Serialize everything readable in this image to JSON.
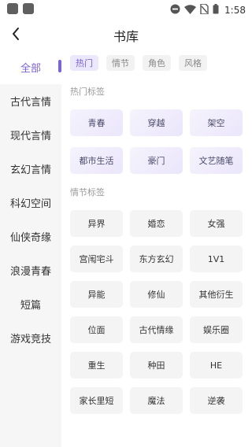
{
  "status_bar": {
    "time": "1:58"
  },
  "header": {
    "title": "书库"
  },
  "sidebar": {
    "items": [
      {
        "label": "全部",
        "active": true
      },
      {
        "label": "古代言情"
      },
      {
        "label": "现代言情"
      },
      {
        "label": "玄幻言情"
      },
      {
        "label": "科幻空间"
      },
      {
        "label": "仙侠奇缘"
      },
      {
        "label": "浪漫青春"
      },
      {
        "label": "短篇"
      },
      {
        "label": "游戏竞技"
      }
    ]
  },
  "filter_tabs": [
    {
      "label": "热门",
      "active": true
    },
    {
      "label": "情节"
    },
    {
      "label": "角色"
    },
    {
      "label": "风格"
    }
  ],
  "hot_section": {
    "title": "热门标签",
    "tags": [
      "青春",
      "穿越",
      "架空",
      "都市生活",
      "豪门",
      "文艺随笔"
    ]
  },
  "plot_section": {
    "title": "情节标签",
    "tags": [
      "异界",
      "婚恋",
      "女强",
      "宫闱宅斗",
      "东方玄幻",
      "1V1",
      "异能",
      "修仙",
      "其他衍生",
      "位面",
      "古代情缘",
      "娱乐圈",
      "重生",
      "种田",
      "HE",
      "家长里短",
      "魔法",
      "逆袭"
    ]
  },
  "colors": {
    "accent": "#7b63d8",
    "sidebar_bg": "#f6f6f6",
    "tag_bg": "#f4f4f4"
  }
}
